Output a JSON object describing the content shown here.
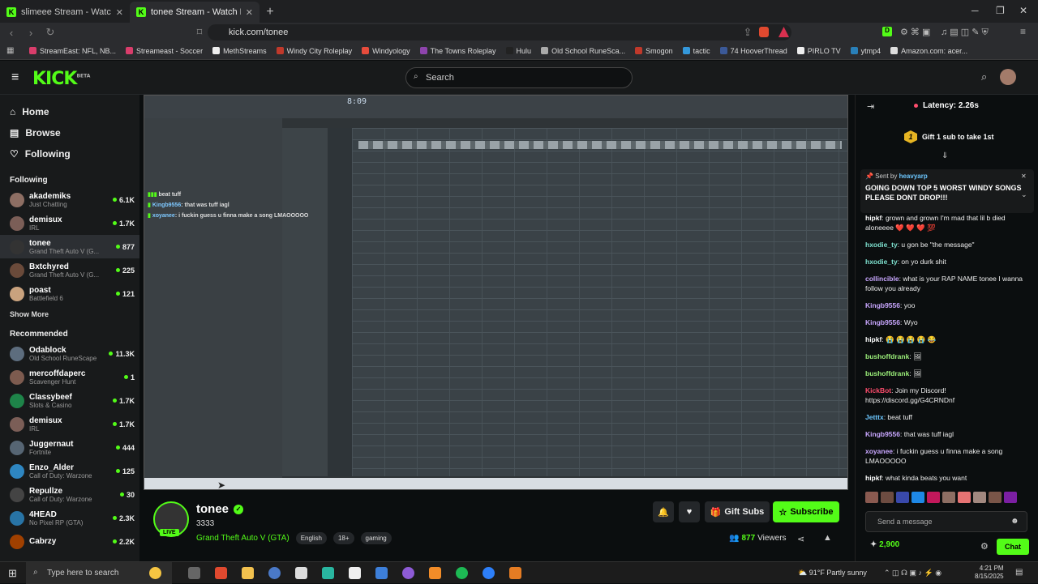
{
  "browser": {
    "tabs": [
      {
        "title": "slimeee Stream - Watch Live on Kick",
        "active": false
      },
      {
        "title": "tonee Stream - Watch Live on Kick",
        "active": true
      }
    ],
    "url": "kick.com/tonee",
    "bookmarks": [
      "StreamEast: NFL, NB...",
      "Streameast - Soccer",
      "MethStreams",
      "Windy City Roleplay",
      "Windyology",
      "The Towns Roleplay",
      "Hulu",
      "Old School RuneSca...",
      "Smogon",
      "tactic",
      "74 HooverThread",
      "PIRLO TV",
      "ytmp4",
      "Amazon.com: acer..."
    ]
  },
  "header": {
    "logo": "KICK",
    "logo_tag": "BETA",
    "search_placeholder": "Search"
  },
  "sidebar": {
    "nav": [
      {
        "label": "Home",
        "icon": "home-icon"
      },
      {
        "label": "Browse",
        "icon": "browse-icon"
      },
      {
        "label": "Following",
        "icon": "heart-icon"
      }
    ],
    "following_title": "Following",
    "following": [
      {
        "name": "akademiks",
        "game": "Just Chatting",
        "viewers": "6.1K"
      },
      {
        "name": "demisux",
        "game": "IRL",
        "viewers": "1.7K"
      },
      {
        "name": "tonee",
        "game": "Grand Theft Auto V (G...",
        "viewers": "877"
      },
      {
        "name": "Bxtchyred",
        "game": "Grand Theft Auto V (G...",
        "viewers": "225"
      },
      {
        "name": "poast",
        "game": "Battlefield 6",
        "viewers": "121"
      }
    ],
    "show_more": "Show More",
    "recommended_title": "Recommended",
    "recommended": [
      {
        "name": "Odablock",
        "game": "Old School RuneScape",
        "viewers": "11.3K"
      },
      {
        "name": "mercoffdaperc",
        "game": "Scavenger Hunt",
        "viewers": "1"
      },
      {
        "name": "Classybeef",
        "game": "Slots & Casino",
        "viewers": "1.7K"
      },
      {
        "name": "demisux",
        "game": "IRL",
        "viewers": "1.7K"
      },
      {
        "name": "Juggernaut",
        "game": "Fortnite",
        "viewers": "444"
      },
      {
        "name": "Enzo_Alder",
        "game": "Call of Duty: Warzone",
        "viewers": "125"
      },
      {
        "name": "Repullze",
        "game": "Call of Duty: Warzone",
        "viewers": "30"
      },
      {
        "name": "4HEAD",
        "game": "No Pixel RP (GTA)",
        "viewers": "2.3K"
      },
      {
        "name": "Cabrzy",
        "game": "",
        "viewers": "2.2K"
      }
    ]
  },
  "video": {
    "clock": "8:09",
    "overlay_chat": [
      {
        "user": "",
        "msg": "beat tuff"
      },
      {
        "user": "Kingb9556",
        "msg": "that was tuff iagl"
      },
      {
        "user": "xoyanee",
        "msg": "i fuckin guess u finna make a song LMAOOOOO"
      }
    ]
  },
  "stream": {
    "name": "tonee",
    "live": "LIVE",
    "title": "3333",
    "category": "Grand Theft Auto V (GTA)",
    "tags": [
      "English",
      "18+",
      "gaming"
    ],
    "gift_subs": "Gift Subs",
    "subscribe": "Subscribe",
    "viewers": "877",
    "viewers_label": "Viewers"
  },
  "chat": {
    "latency": "Latency: 2.26s",
    "gift_rank": "1",
    "gift_text": "Gift 1 sub to take 1st",
    "pinned_by_label": "Sent by",
    "pinned_by": "heavyarp",
    "pinned_msg": "GOING DOWN TOP 5 WORST WINDY SONGS PLEASE DONT DROP!!!",
    "messages": [
      {
        "user": "hipkf",
        "color": "#ffffff",
        "text": "grown and grown I'm mad that lil b died aloneeee ❤️ ❤️ ❤️ 💯"
      },
      {
        "user": "hxodie_ty",
        "color": "#7fe3d1",
        "text": "u gon be \"the message\""
      },
      {
        "user": "hxodie_ty",
        "color": "#7fe3d1",
        "text": "on yo durk shit"
      },
      {
        "user": "collincible",
        "color": "#c9a7ff",
        "text": "what is your RAP NAME tonee I wanna follow you already"
      },
      {
        "user": "Kingb9556",
        "color": "#c9a7ff",
        "text": "yoo"
      },
      {
        "user": "Kingb9556",
        "color": "#c9a7ff",
        "text": "Wyo"
      },
      {
        "user": "hipkf",
        "color": "#ffffff",
        "text": "😭 😭 😭 😭 😂"
      },
      {
        "user": "bushoffdrank",
        "color": "#9cf07a",
        "text": "🖼"
      },
      {
        "user": "bushoffdrank",
        "color": "#9cf07a",
        "text": "🖼"
      },
      {
        "user": "KickBot",
        "color": "#ff4d6d",
        "text": "Join my Discord! https://discord.gg/G4CRNDnf"
      },
      {
        "user": "Jetttx",
        "color": "#6cc7ff",
        "text": "beat tuff"
      },
      {
        "user": "Kingb9556",
        "color": "#c9a7ff",
        "text": "that was tuff iagl"
      },
      {
        "user": "xoyanee",
        "color": "#c9a7ff",
        "text": "i fuckin guess u finna make a song LMAOOOOO"
      },
      {
        "user": "hipkf",
        "color": "#ffffff",
        "text": "what kinda beats you want"
      }
    ],
    "send_placeholder": "Send a message",
    "points": "2,900",
    "chat_button": "Chat"
  },
  "taskbar": {
    "search": "Type here to search",
    "weather": "91°F  Partly sunny",
    "time": "4:21 PM",
    "date": "8/15/2025"
  }
}
